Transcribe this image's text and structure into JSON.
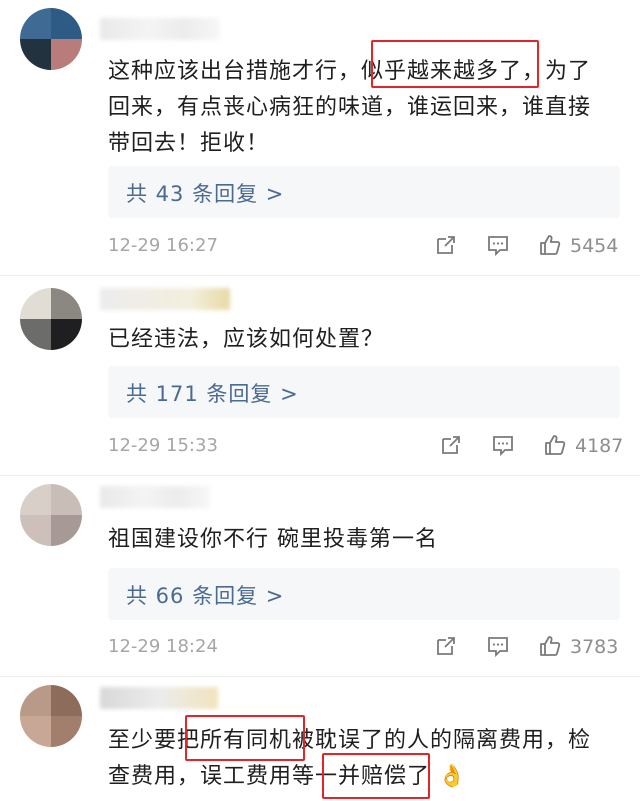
{
  "comments": [
    {
      "text_line1": "这种应该出台措施才行，似乎越来越多了，为了",
      "text_line2": "回来，有点丧心病狂的味道，谁运回来，谁直接",
      "text_line3": "带回去！拒收！",
      "replies": "共 43 条回复 >",
      "time": "12-29 16:27",
      "likes": "5454"
    },
    {
      "text_line1": "已经违法，应该如何处置？",
      "replies": "共 171 条回复 >",
      "time": "12-29 15:33",
      "likes": "4187"
    },
    {
      "text_line1": "祖国建设你不行 碗里投毒第一名",
      "replies": "共 66 条回复 >",
      "time": "12-29 18:24",
      "likes": "3783"
    },
    {
      "text_line1": "至少要把所有同机被耽误了的人的隔离费用，检",
      "text_line2": "查费用，误工费用等一并赔偿了",
      "emoji": "👌"
    }
  ],
  "icons": {
    "share": "share-icon",
    "comment": "comment-icon",
    "like": "thumbs-up-icon"
  },
  "colors": {
    "reply_link": "#4a6a91",
    "highlight_box": "#e0262b",
    "reply_bg": "#f6f7f9"
  }
}
